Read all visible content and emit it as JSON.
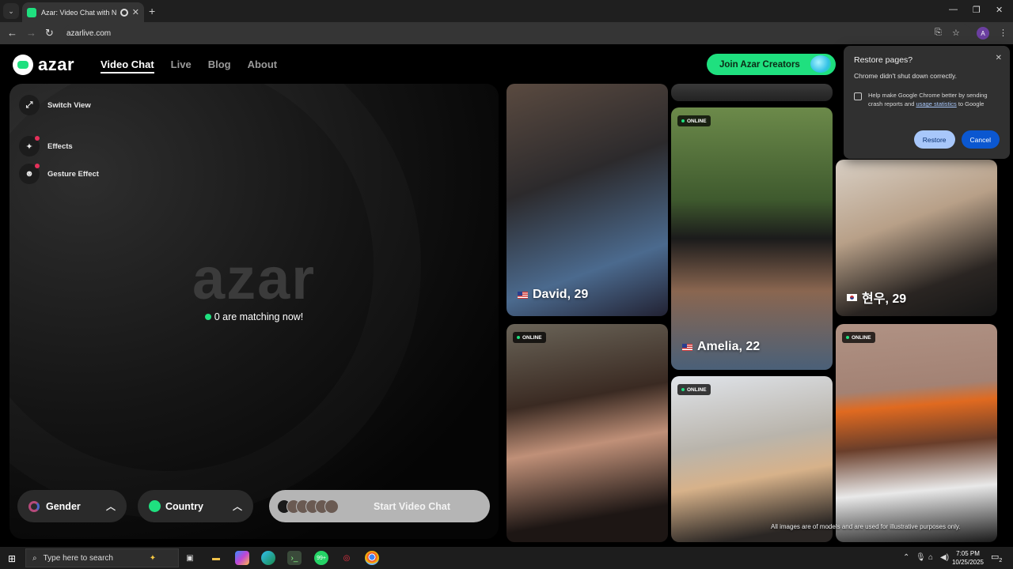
{
  "browser": {
    "tab_title": "Azar: Video Chat with New",
    "url": "azarlive.com",
    "profile_initial": "A"
  },
  "header": {
    "logo": "azar",
    "nav": [
      "Video Chat",
      "Live",
      "Blog",
      "About"
    ],
    "join_button": "Join Azar Creators"
  },
  "video_panel": {
    "switch_view": "Switch View",
    "effects": "Effects",
    "gesture_effect": "Gesture Effect",
    "watermark": "azar",
    "matching_text": "0 are matching now!",
    "gender_label": "Gender",
    "country_label": "Country",
    "start_label": "Start Video Chat"
  },
  "grid": {
    "online_label": "ONLINE",
    "names": {
      "david": "David, 29",
      "amelia": "Amelia, 22",
      "hyunwoo": "현우, 29"
    },
    "disclaimer": "All images are of models and are used for illustrative purposes only."
  },
  "dialog": {
    "title": "Restore pages?",
    "message": "Chrome didn't shut down correctly.",
    "checkbox_text": "Help make Google Chrome better by sending crash reports and",
    "checkbox_link": "usage statistics",
    "checkbox_tail": "to Google",
    "restore_button": "Restore",
    "cancel_button": "Cancel"
  },
  "taskbar": {
    "search_placeholder": "Type here to search",
    "time": "7:05 PM",
    "date": "10/25/2025",
    "badge": "99+",
    "notifications": "2"
  }
}
